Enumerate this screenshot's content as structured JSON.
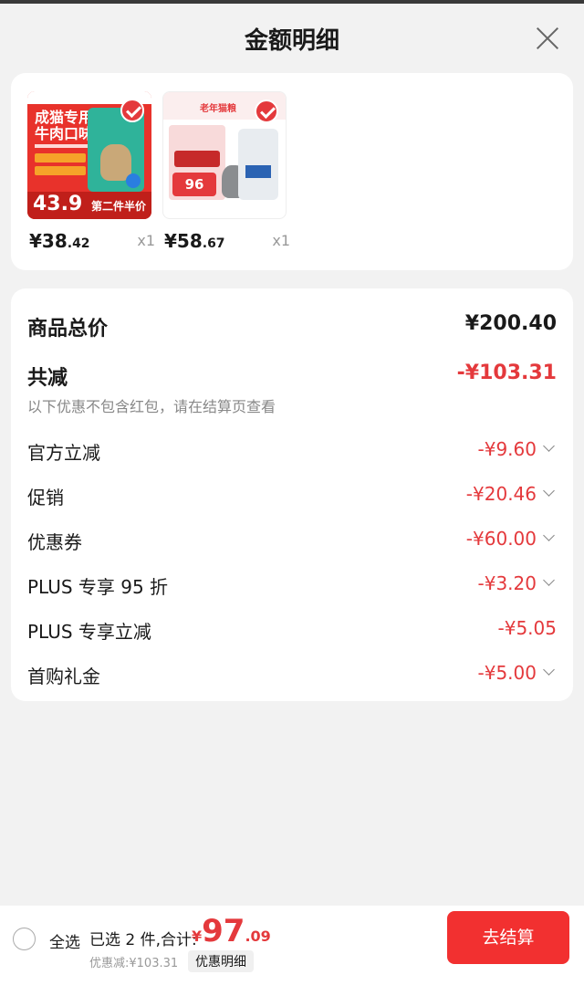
{
  "header": {
    "title": "金额明细"
  },
  "products": [
    {
      "price_main": "¥38",
      "price_dec": ".42",
      "qty": "x1",
      "art": {
        "headline_1": "成猫专用",
        "headline_2": "牛肉口味",
        "big_price": "43.9",
        "promo": "第二件半价"
      }
    },
    {
      "price_main": "¥58",
      "price_dec": ".67",
      "qty": "x1",
      "art": {
        "headline": "老年猫粮",
        "big_price": "96"
      }
    }
  ],
  "details": {
    "total_label": "商品总价",
    "total_value": "¥200.40",
    "reduce_label": "共减",
    "reduce_value": "-¥103.31",
    "note": "以下优惠不包含红包，请在结算页查看",
    "items": [
      {
        "label": "官方立减",
        "value": "-¥9.60"
      },
      {
        "label": "促销",
        "value": "-¥20.46"
      },
      {
        "label": "优惠券",
        "value": "-¥60.00"
      },
      {
        "label": "PLUS 专享 95 折",
        "value": "-¥3.20"
      },
      {
        "label": "PLUS 专享立减",
        "value": "-¥5.05"
      },
      {
        "label": "首购礼金",
        "value": "-¥5.00"
      }
    ]
  },
  "footer": {
    "select_all": "全选",
    "selected": "已选 2 件,合计:",
    "currency": "¥",
    "total_int": "97",
    "total_dec": ".09",
    "discount": "优惠减:¥103.31",
    "discount_detail": "优惠明细",
    "checkout": "去结算"
  },
  "colors": {
    "accent": "#e4393c",
    "checkout": "#f23030",
    "background": "#f2f2f2"
  }
}
